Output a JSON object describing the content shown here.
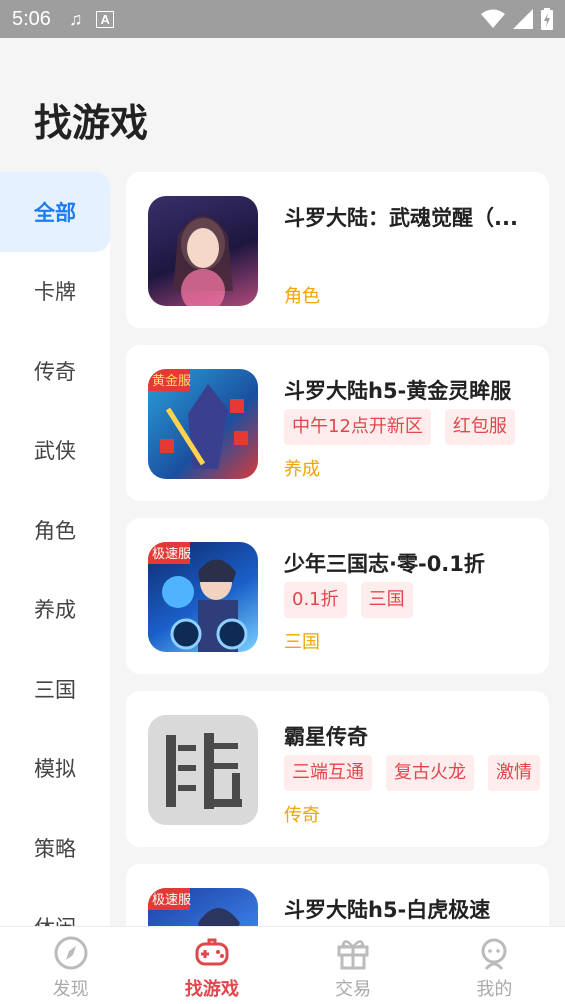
{
  "status": {
    "time": "5:06"
  },
  "page": {
    "title": "找游戏"
  },
  "sidebar": {
    "items": [
      {
        "label": "全部",
        "active": true
      },
      {
        "label": "卡牌"
      },
      {
        "label": "传奇"
      },
      {
        "label": "武侠"
      },
      {
        "label": "角色"
      },
      {
        "label": "养成"
      },
      {
        "label": "三国"
      },
      {
        "label": "模拟"
      },
      {
        "label": "策略"
      },
      {
        "label": "休闲"
      }
    ]
  },
  "games": [
    {
      "name": "斗罗大陆：武魂觉醒（...",
      "tags": [],
      "genre": "角色"
    },
    {
      "name": "斗罗大陆h5-黄金灵眸服",
      "tags": [
        "中午12点开新区",
        "红包服"
      ],
      "genre": "养成",
      "badge": "黄金服"
    },
    {
      "name": "少年三国志·零-0.1折",
      "tags": [
        "0.1折",
        "三国"
      ],
      "genre": "三国",
      "badge": "极速服"
    },
    {
      "name": "霸星传奇",
      "tags": [
        "三端互通",
        "复古火龙",
        "激情"
      ],
      "genre": "传奇"
    },
    {
      "name": "斗罗大陆h5-白虎极速",
      "tags": [],
      "genre": "",
      "badge": "极速服"
    }
  ],
  "tabbar": {
    "items": [
      {
        "label": "发现",
        "icon": "compass-icon"
      },
      {
        "label": "找游戏",
        "icon": "gamepad-icon",
        "active": true
      },
      {
        "label": "交易",
        "icon": "gift-icon"
      },
      {
        "label": "我的",
        "icon": "user-icon"
      }
    ]
  },
  "colors": {
    "accent_blue": "#1e7cf2",
    "accent_red": "#e0474c",
    "genre_orange": "#f2a400"
  }
}
